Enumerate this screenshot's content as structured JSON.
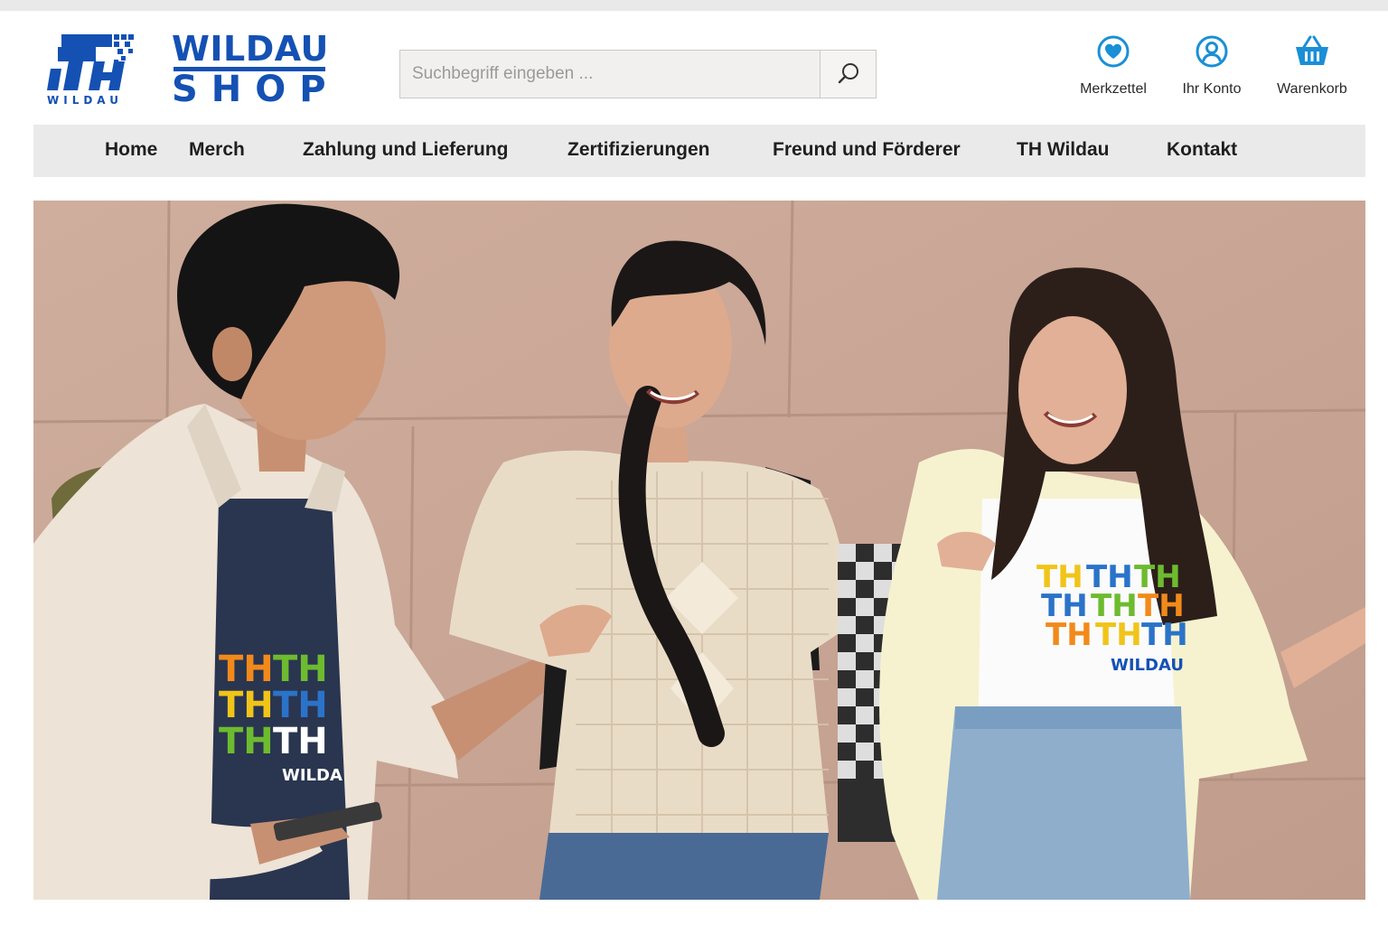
{
  "header": {
    "logo": {
      "mark_text": "WILDAU",
      "line1": "WILDAU",
      "line2": "SHOP"
    },
    "search": {
      "placeholder": "Suchbegriff eingeben ...",
      "value": "",
      "button_icon": "search-icon"
    },
    "actions": [
      {
        "icon": "heart-icon",
        "label": "Merkzettel"
      },
      {
        "icon": "user-icon",
        "label": "Ihr Konto"
      },
      {
        "icon": "basket-icon",
        "label": "Warenkorb"
      }
    ]
  },
  "nav": {
    "items": [
      {
        "label": "Home"
      },
      {
        "label": "Merch"
      },
      {
        "label": "Zahlung und Lieferung"
      },
      {
        "label": "Zertifizierungen"
      },
      {
        "label": "Freund und Förderer"
      },
      {
        "label": "TH Wildau"
      },
      {
        "label": "Kontakt"
      }
    ]
  },
  "hero": {
    "shirt_prints": [
      {
        "text": "THTHTH",
        "subtext": "WILDA"
      },
      {
        "text": "THTHTH",
        "subtext": "WILDAU"
      }
    ]
  },
  "colors": {
    "brand_blue": "#1451b3",
    "icon_blue": "#1a8fd6",
    "nav_background": "#eaeaea",
    "search_background": "#f1f0ef",
    "print_yellow": "#f0c419",
    "print_orange": "#f28a1a",
    "print_green": "#6dbb2f",
    "print_blue": "#2a73c9"
  }
}
